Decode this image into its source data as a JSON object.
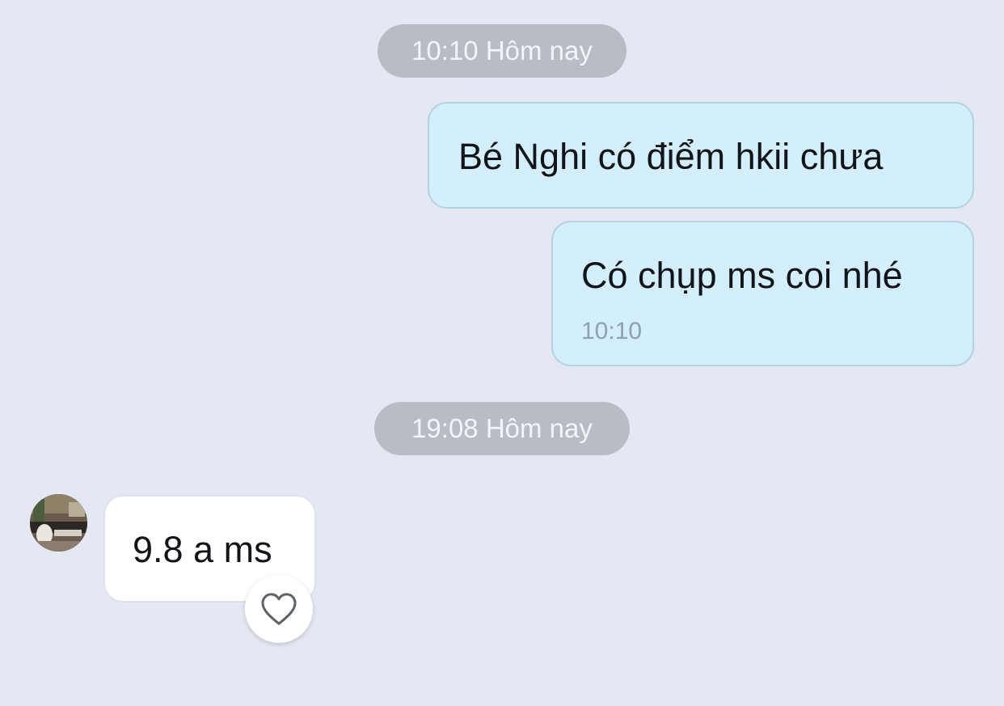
{
  "chat": {
    "separators": [
      {
        "time": "10:10",
        "label": "Hôm nay"
      },
      {
        "time": "19:08",
        "label": "Hôm nay"
      }
    ],
    "messages": [
      {
        "direction": "outgoing",
        "text": "Bé Nghi có điểm hkii chưa"
      },
      {
        "direction": "outgoing",
        "text": "Có chụp ms coi nhé",
        "time": "10:10"
      },
      {
        "direction": "incoming",
        "text": "9.8 a ms"
      }
    ]
  },
  "icons": {
    "reaction": "heart-outline-icon",
    "sender": "avatar-photo"
  },
  "colors": {
    "background": "#e4e8f2",
    "outgoing_bubble": "#d3eefd",
    "incoming_bubble": "#ffffff",
    "separator_pill": "#b9bcc4"
  }
}
